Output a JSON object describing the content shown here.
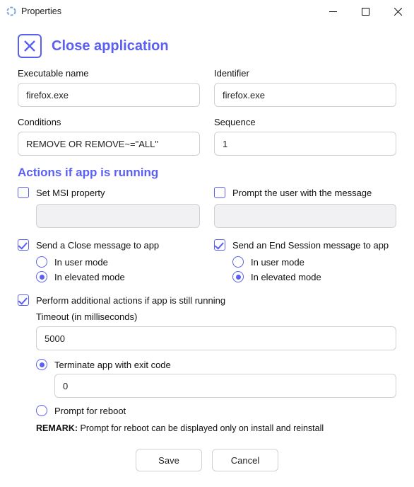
{
  "titlebar": {
    "title": "Properties"
  },
  "hero": {
    "title": "Close application"
  },
  "fields": {
    "exec": {
      "label": "Executable name",
      "value": "firefox.exe"
    },
    "ident": {
      "label": "Identifier",
      "value": "firefox.exe"
    },
    "cond": {
      "label": "Conditions",
      "value": "REMOVE OR REMOVE~=\"ALL\""
    },
    "seq": {
      "label": "Sequence",
      "value": "1"
    }
  },
  "actions_title": "Actions if app is running",
  "opt": {
    "set_msi": {
      "label": "Set MSI property",
      "checked": false
    },
    "prompt_msg": {
      "label": "Prompt the user with the message",
      "checked": false
    },
    "close_msg": {
      "label": "Send a Close message to app",
      "checked": true,
      "user": "In user mode",
      "elev": "In elevated mode",
      "sel": "elev"
    },
    "end_sess": {
      "label": "Send an End Session message to app",
      "checked": true,
      "user": "In user mode",
      "elev": "In elevated mode",
      "sel": "elev"
    },
    "perform": {
      "label": "Perform additional actions if app is still running",
      "checked": true
    },
    "timeout": {
      "label": "Timeout (in milliseconds)",
      "value": "5000"
    },
    "term": {
      "label": "Terminate app with exit code",
      "value": "0",
      "sel": true
    },
    "reboot": {
      "label": "Prompt for reboot",
      "sel": false
    },
    "remark_head": "REMARK:",
    "remark": " Prompt for reboot can be displayed only on install and reinstall"
  },
  "buttons": {
    "save": "Save",
    "cancel": "Cancel"
  }
}
